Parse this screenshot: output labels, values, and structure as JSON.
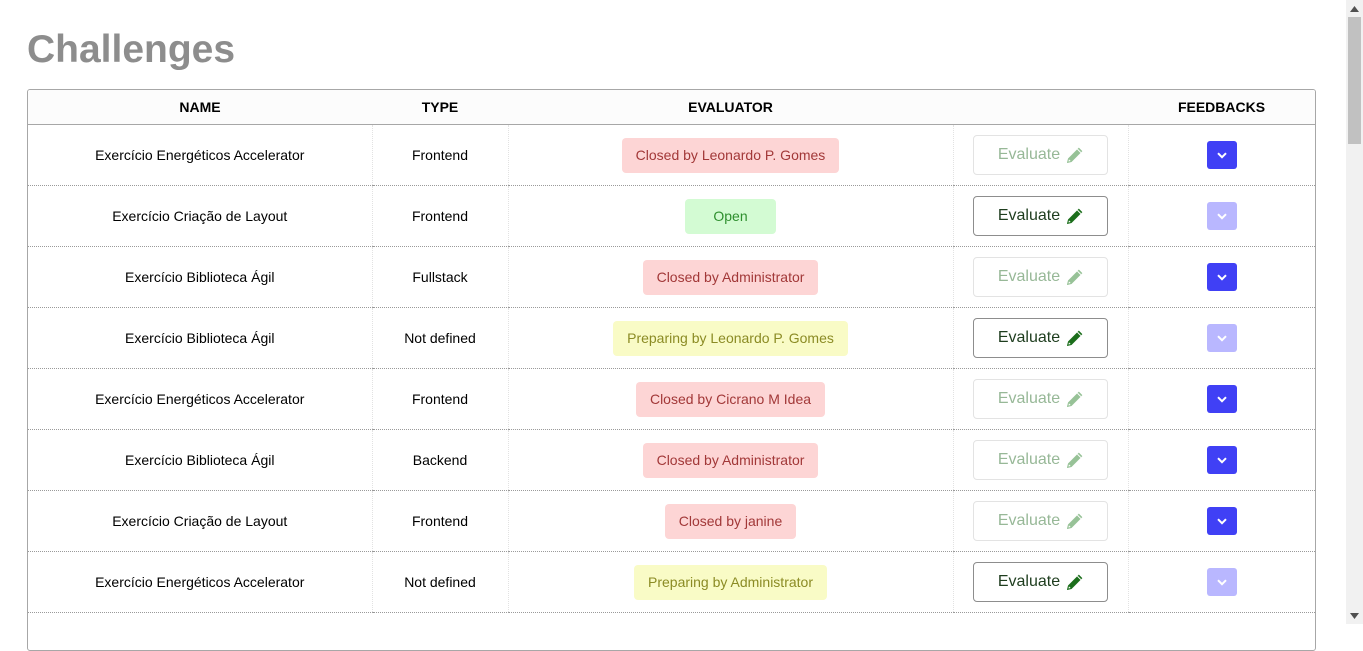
{
  "page": {
    "title": "Challenges"
  },
  "table": {
    "headers": [
      "NAME",
      "TYPE",
      "EVALUATOR",
      "",
      "FEEDBACKS"
    ],
    "rows": [
      {
        "name": "Exercício Energéticos Accelerator",
        "type": "Frontend",
        "evaluator": "Closed by Leonardo P. Gomes",
        "status": "closed",
        "evaluate_label": "Evaluate",
        "evaluate_enabled": false,
        "feedback_enabled": true
      },
      {
        "name": "Exercício Criação de Layout",
        "type": "Frontend",
        "evaluator": "Open",
        "status": "open",
        "evaluate_label": "Evaluate",
        "evaluate_enabled": true,
        "feedback_enabled": false
      },
      {
        "name": "Exercício Biblioteca Ágil",
        "type": "Fullstack",
        "evaluator": "Closed by Administrator",
        "status": "closed",
        "evaluate_label": "Evaluate",
        "evaluate_enabled": false,
        "feedback_enabled": true
      },
      {
        "name": "Exercício Biblioteca Ágil",
        "type": "Not defined",
        "evaluator": "Preparing by Leonardo P. Gomes",
        "status": "preparing",
        "evaluate_label": "Evaluate",
        "evaluate_enabled": true,
        "feedback_enabled": false
      },
      {
        "name": "Exercício Energéticos Accelerator",
        "type": "Frontend",
        "evaluator": "Closed by Cicrano M Idea",
        "status": "closed",
        "evaluate_label": "Evaluate",
        "evaluate_enabled": false,
        "feedback_enabled": true
      },
      {
        "name": "Exercício Biblioteca Ágil",
        "type": "Backend",
        "evaluator": "Closed by Administrator",
        "status": "closed",
        "evaluate_label": "Evaluate",
        "evaluate_enabled": false,
        "feedback_enabled": true
      },
      {
        "name": "Exercício Criação de Layout",
        "type": "Frontend",
        "evaluator": "Closed by janine",
        "status": "closed",
        "evaluate_label": "Evaluate",
        "evaluate_enabled": false,
        "feedback_enabled": true
      },
      {
        "name": "Exercício Energéticos Accelerator",
        "type": "Not defined",
        "evaluator": "Preparing by Administrator",
        "status": "preparing",
        "evaluate_label": "Evaluate",
        "evaluate_enabled": true,
        "feedback_enabled": false
      }
    ]
  },
  "icons": {
    "evaluate": "pencil-icon",
    "feedback": "chevron-down-icon"
  },
  "colors": {
    "closed_bg": "#fdd5d5",
    "closed_text": "#a23838",
    "open_bg": "#d3fbd3",
    "open_text": "#2e8f2e",
    "preparing_bg": "#f9fbc6",
    "preparing_text": "#8b8b24",
    "feedback_enabled": "#4040f5",
    "feedback_disabled": "#b9b7ff"
  }
}
